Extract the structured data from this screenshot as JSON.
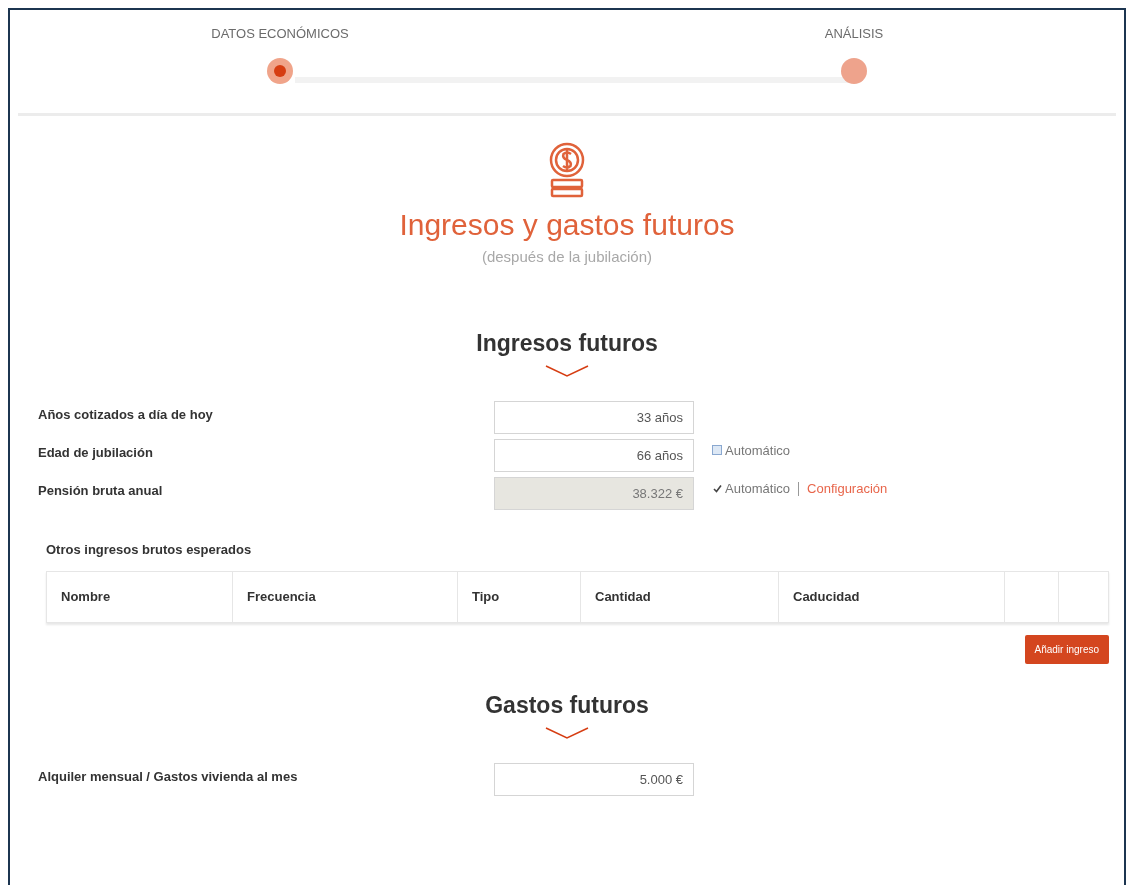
{
  "steps": [
    {
      "label": "DATOS ECONÓMICOS",
      "selected": true
    },
    {
      "label": "ANÁLISIS",
      "selected": false
    }
  ],
  "header": {
    "title": "Ingresos y gastos futuros",
    "subtitle": "(después de la jubilación)"
  },
  "income": {
    "title": "Ingresos futuros",
    "fields": [
      {
        "label": "Años cotizados a día de hoy",
        "value": "33 años",
        "disabled": false
      },
      {
        "label": "Edad de jubilación",
        "value": "66 años",
        "disabled": false,
        "option": {
          "label": "Automático",
          "checked": false
        }
      },
      {
        "label": "Pensión bruta anual",
        "value": "38.322 €",
        "disabled": true,
        "option": {
          "label": "Automático",
          "checked": true
        },
        "link": "Configuración"
      }
    ],
    "table_title": "Otros ingresos brutos esperados",
    "columns": [
      "Nombre",
      "Frecuencia",
      "Tipo",
      "Cantidad",
      "Caducidad"
    ],
    "add_button": "Añadir ingreso"
  },
  "expenses": {
    "title": "Gastos futuros",
    "fields": [
      {
        "label": "Alquiler mensual / Gastos vivienda al mes",
        "value": "5.000 €",
        "disabled": false
      }
    ]
  }
}
